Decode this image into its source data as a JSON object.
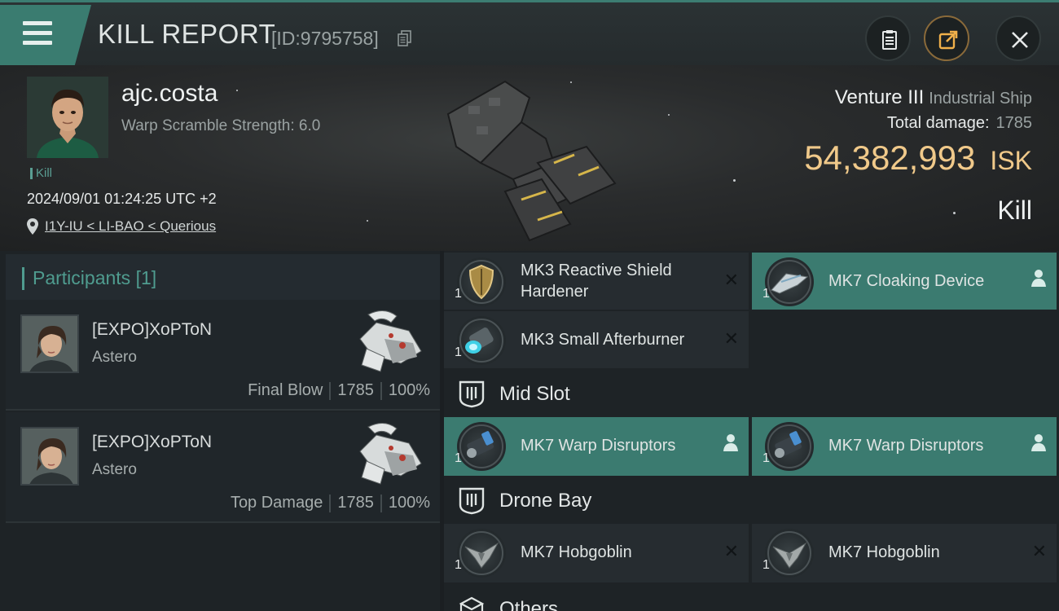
{
  "header": {
    "title": "KILL REPORT",
    "report_id": "[ID:9795758]"
  },
  "victim": {
    "pilot_name": "ajc.costa",
    "warp_scramble": "Warp Scramble Strength: 6.0",
    "kill_tag": "Kill",
    "timestamp": "2024/09/01 01:24:25 UTC +2",
    "location": "I1Y-IU < LI-BAO < Querious",
    "ship_name": "Venture III",
    "ship_class": "Industrial Ship",
    "total_damage_label": "Total damage:",
    "total_damage_value": "1785",
    "isk_value": "54,382,993",
    "isk_unit": "ISK",
    "result": "Kill"
  },
  "participants": {
    "header_label": "Participants",
    "header_count": "[1]",
    "rows": [
      {
        "name": "[EXPO]XoPToN",
        "ship": "Astero",
        "role": "Final Blow",
        "damage": "1785",
        "percent": "100%"
      },
      {
        "name": "[EXPO]XoPToN",
        "ship": "Astero",
        "role": "Top Damage",
        "damage": "1785",
        "percent": "100%"
      }
    ]
  },
  "fitting": {
    "low_slots": [
      {
        "name": "MK3 Reactive Shield Hardener",
        "qty": "1",
        "state": "destroyed",
        "icon": "shield-hardener-icon"
      },
      {
        "name": "MK7 Cloaking Device",
        "qty": "1",
        "state": "dropped",
        "icon": "cloaking-device-icon"
      },
      {
        "name": "MK3 Small Afterburner",
        "qty": "1",
        "state": "destroyed",
        "icon": "afterburner-icon"
      }
    ],
    "mid_slot_label": "Mid Slot",
    "mid_slots": [
      {
        "name": "MK7 Warp Disruptors",
        "qty": "1",
        "state": "dropped",
        "icon": "warp-disruptor-icon"
      },
      {
        "name": "MK7 Warp Disruptors",
        "qty": "1",
        "state": "dropped",
        "icon": "warp-disruptor-icon"
      }
    ],
    "drone_bay_label": "Drone Bay",
    "drones": [
      {
        "name": "MK7  Hobgoblin",
        "qty": "1",
        "state": "destroyed",
        "icon": "drone-icon"
      },
      {
        "name": "MK7  Hobgoblin",
        "qty": "1",
        "state": "destroyed",
        "icon": "drone-icon"
      }
    ],
    "others_label": "Others"
  },
  "colors": {
    "accent": "#3b7b70",
    "isk": "#f0c98a",
    "panel": "#262c30"
  }
}
